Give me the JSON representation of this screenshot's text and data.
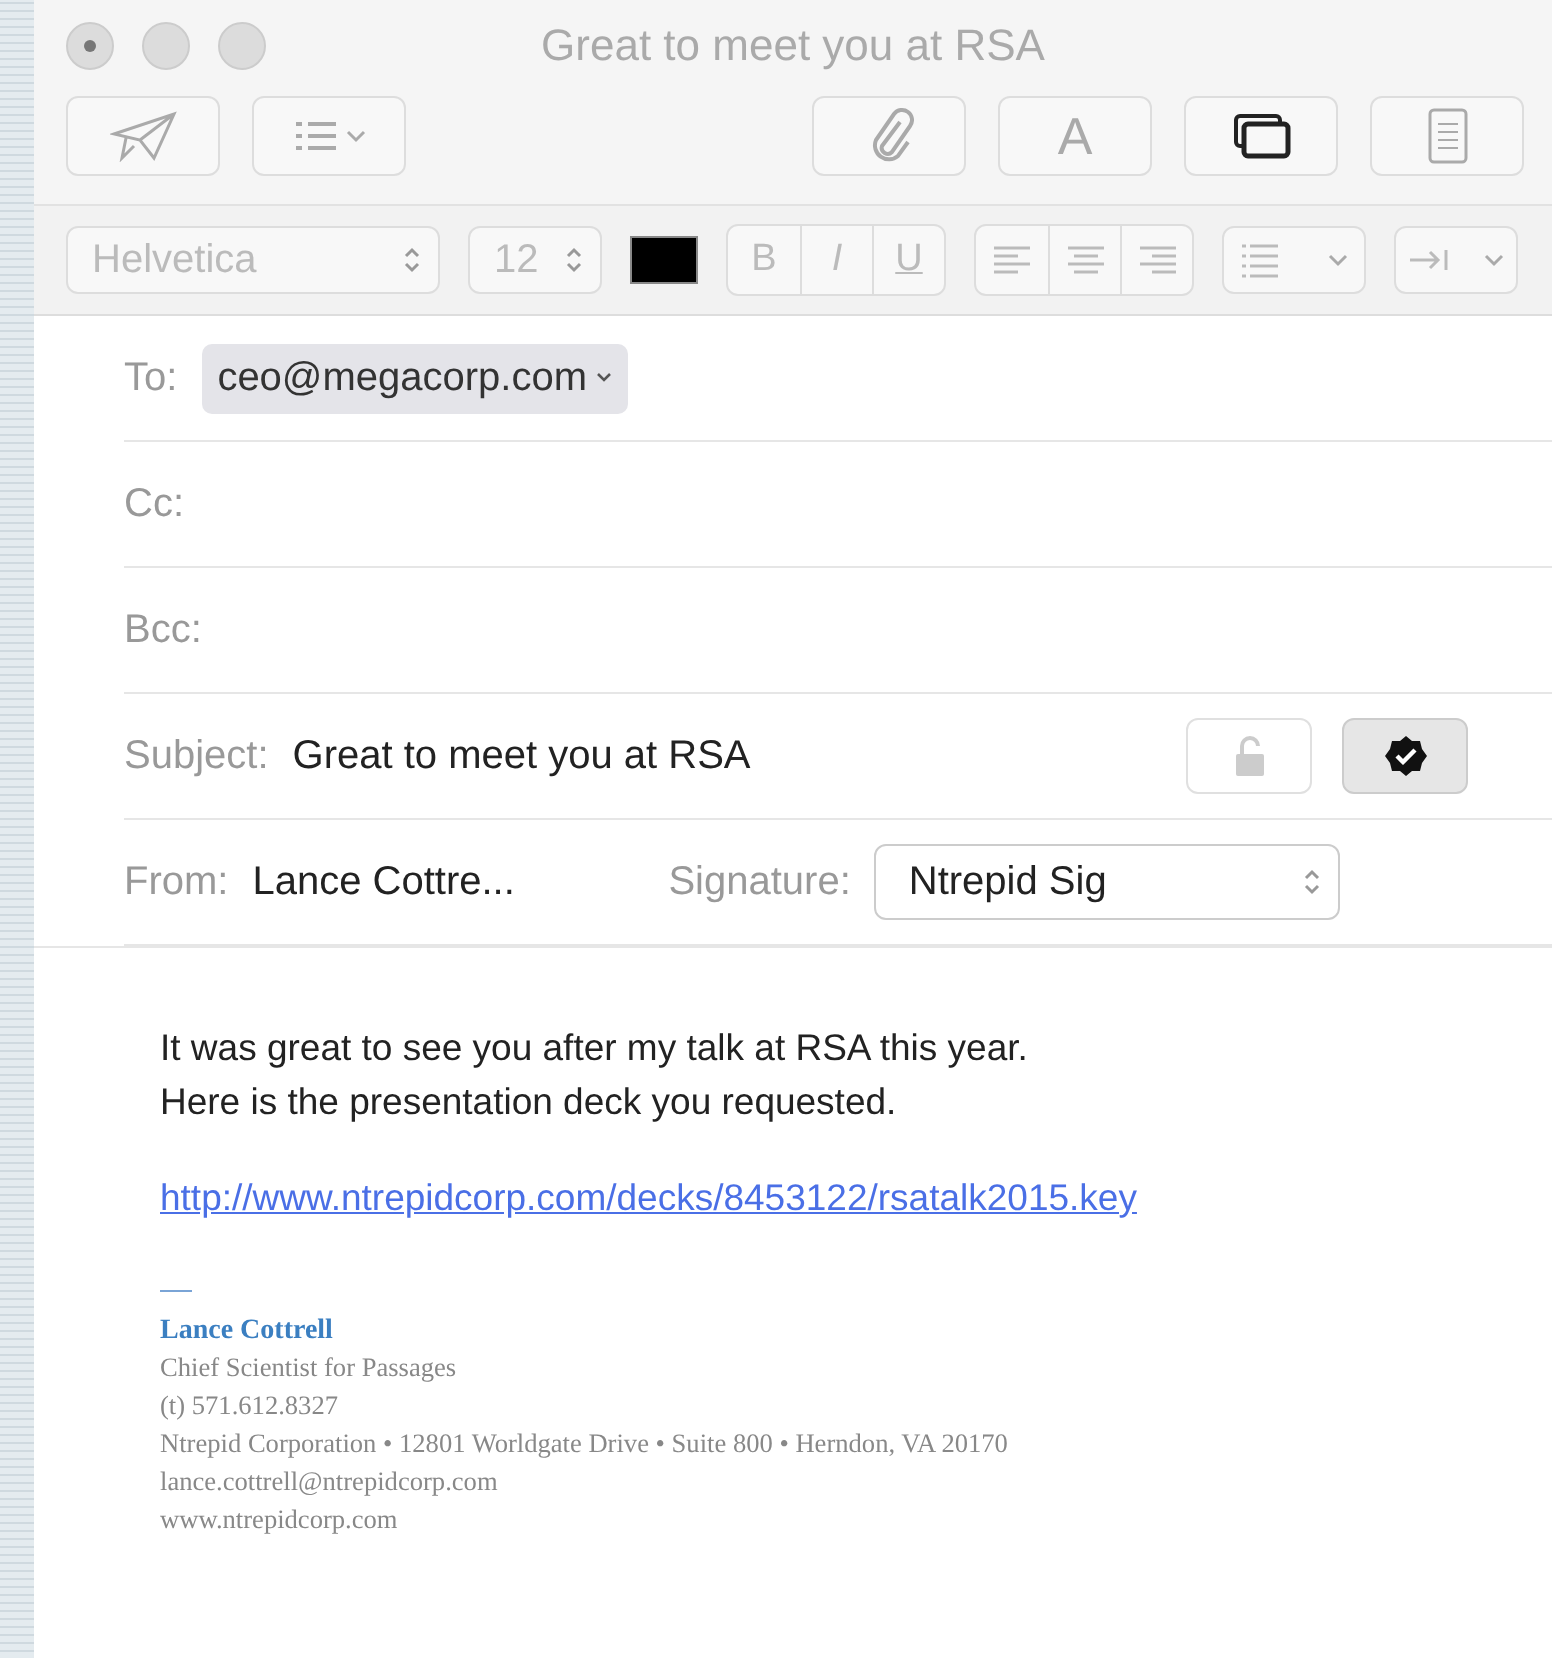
{
  "window": {
    "title": "Great to meet you at RSA",
    "traffic_lights": [
      {
        "kind": "close"
      },
      {
        "kind": "minimize"
      },
      {
        "kind": "zoom"
      }
    ]
  },
  "toolbar": {
    "left": [
      {
        "kind": "send"
      },
      {
        "kind": "list"
      }
    ],
    "right": [
      {
        "kind": "attach"
      },
      {
        "kind": "fonts",
        "label": "A"
      },
      {
        "kind": "photos",
        "active": true
      },
      {
        "kind": "stationery"
      }
    ]
  },
  "format_bar": {
    "font": "Helvetica",
    "size": "12",
    "styles": [
      "B",
      "I",
      "U"
    ],
    "alignments": [
      {
        "kind": "left"
      },
      {
        "kind": "center"
      },
      {
        "kind": "right"
      }
    ]
  },
  "header": {
    "to": {
      "label": "To:",
      "recipients": [
        "ceo@megacorp.com"
      ]
    },
    "cc": {
      "label": "Cc:"
    },
    "bcc": {
      "label": "Bcc:"
    },
    "subject": {
      "label": "Subject:",
      "value": "Great to meet you at RSA",
      "encrypt": {
        "selected": false
      },
      "sign": {
        "selected": true
      }
    },
    "from": {
      "label": "From:",
      "value": "Lance Cottre..."
    },
    "signature": {
      "label": "Signature:",
      "value": "Ntrepid Sig"
    }
  },
  "body": {
    "paragraphs": [
      "It was great to see you after my talk at RSA this year.\nHere is the presentation deck you requested."
    ],
    "link": "http://www.ntrepidcorp.com/decks/8453122/rsatalk2015.key",
    "signature": {
      "name": "Lance Cottrell",
      "lines": [
        "Chief Scientist for Passages",
        "(t) 571.612.8327",
        "Ntrepid Corporation • 12801 Worldgate Drive • Suite 800 • Herndon, VA 20170",
        "lance.cottrell@ntrepidcorp.com",
        "www.ntrepidcorp.com"
      ]
    }
  }
}
